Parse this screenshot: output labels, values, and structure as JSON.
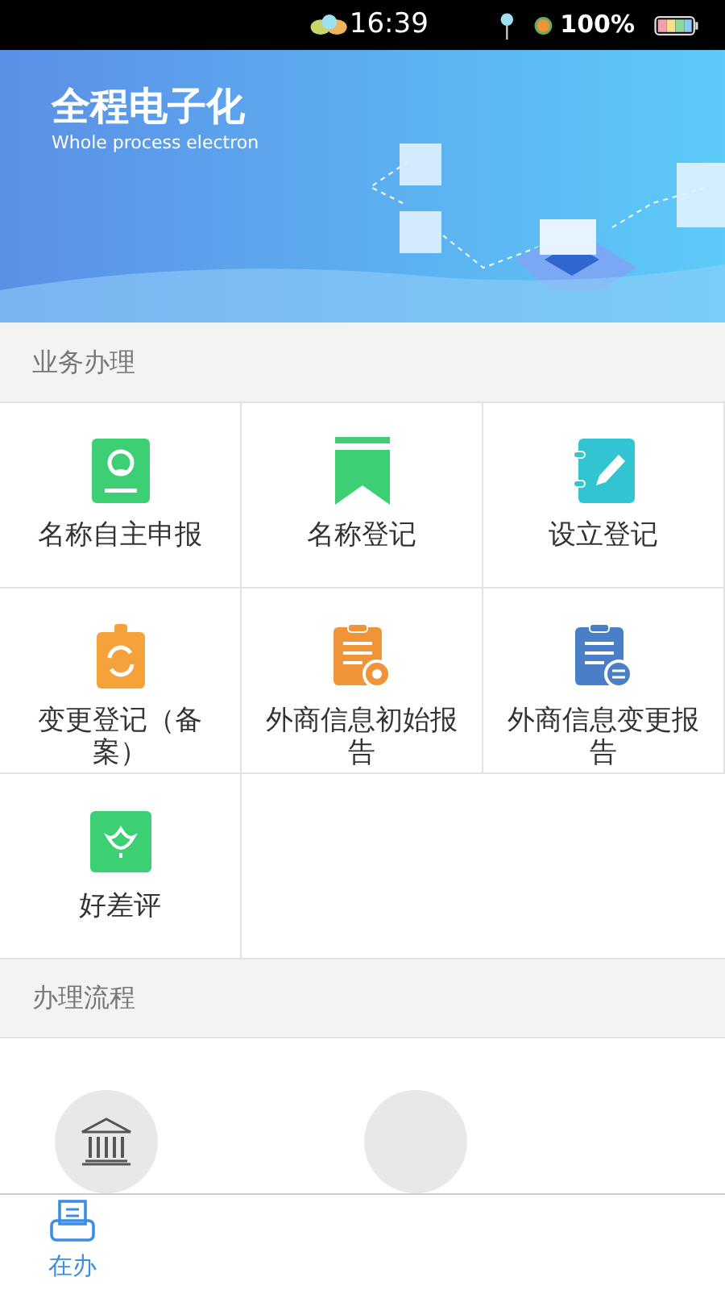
{
  "status_bar": {
    "time": "16:39",
    "battery": "100%"
  },
  "banner": {
    "title": "全程电子化",
    "subtitle": "Whole process electron"
  },
  "business": {
    "heading": "业务办理",
    "items": [
      {
        "label": "名称自主申报",
        "kind": "profile"
      },
      {
        "label": "名称登记",
        "kind": "bookmark"
      },
      {
        "label": "设立登记",
        "kind": "notebook"
      },
      {
        "label": "变更登记（备案）",
        "kind": "clipboard-sync"
      },
      {
        "label": "外商信息初始报告",
        "kind": "report-start"
      },
      {
        "label": "外商信息变更报告",
        "kind": "report-change"
      },
      {
        "label": "好差评",
        "kind": "flower"
      }
    ]
  },
  "process": {
    "heading": "办理流程",
    "steps": [
      {
        "kind": "bank"
      },
      {
        "kind": "blank"
      }
    ]
  },
  "tabs": [
    {
      "label": "在办",
      "selected": true
    }
  ]
}
